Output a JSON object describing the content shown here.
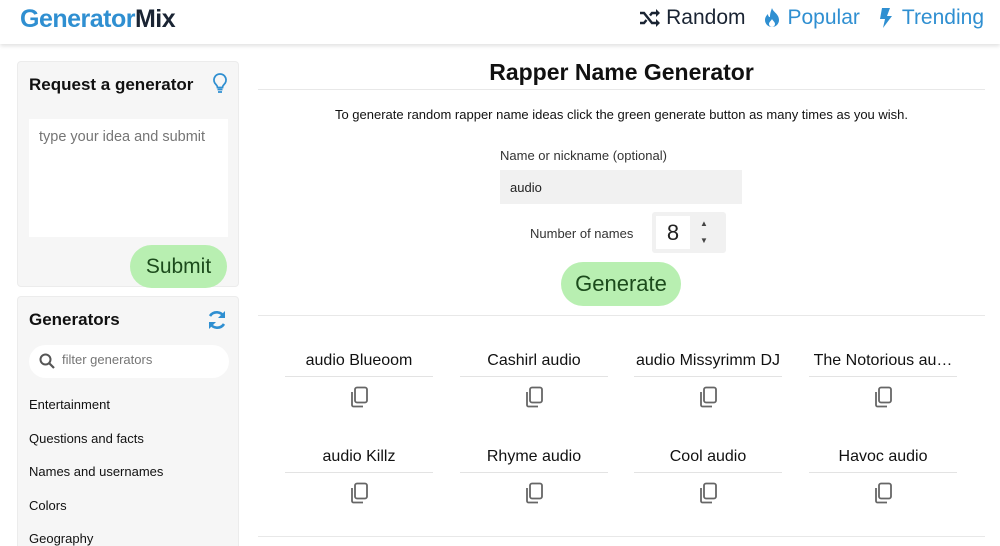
{
  "header": {
    "logo_part1": "Generator",
    "logo_part2": "Mix",
    "nav": {
      "random": "Random",
      "popular": "Popular",
      "trending": "Trending"
    }
  },
  "sidebar": {
    "request": {
      "title": "Request a generator",
      "placeholder": "type your idea and submit",
      "submit": "Submit"
    },
    "generators": {
      "title": "Generators",
      "filter_placeholder": "filter generators",
      "items": [
        "Entertainment",
        "Questions and facts",
        "Names and usernames",
        "Colors",
        "Geography"
      ]
    }
  },
  "main": {
    "title": "Rapper Name Generator",
    "description": "To generate random rapper name ideas click the green generate button as many times as you wish.",
    "name_label": "Name or nickname (optional)",
    "name_value": "audio",
    "count_label": "Number of names",
    "count_value": "8",
    "generate": "Generate",
    "results": [
      "audio Blueoom",
      "Cashirl audio",
      "audio Missyrimm DJ",
      "The Notorious au…",
      "audio Killz",
      "Rhyme audio",
      "Cool audio",
      "Havoc audio"
    ]
  },
  "colors": {
    "brand_blue": "#2f8fd1",
    "brand_dark": "#1a2433",
    "button_green": "#b8efb1"
  },
  "icons": [
    "shuffle-icon",
    "flame-icon",
    "bolt-icon",
    "lightbulb-icon",
    "refresh-icon",
    "search-icon",
    "copy-icon"
  ]
}
